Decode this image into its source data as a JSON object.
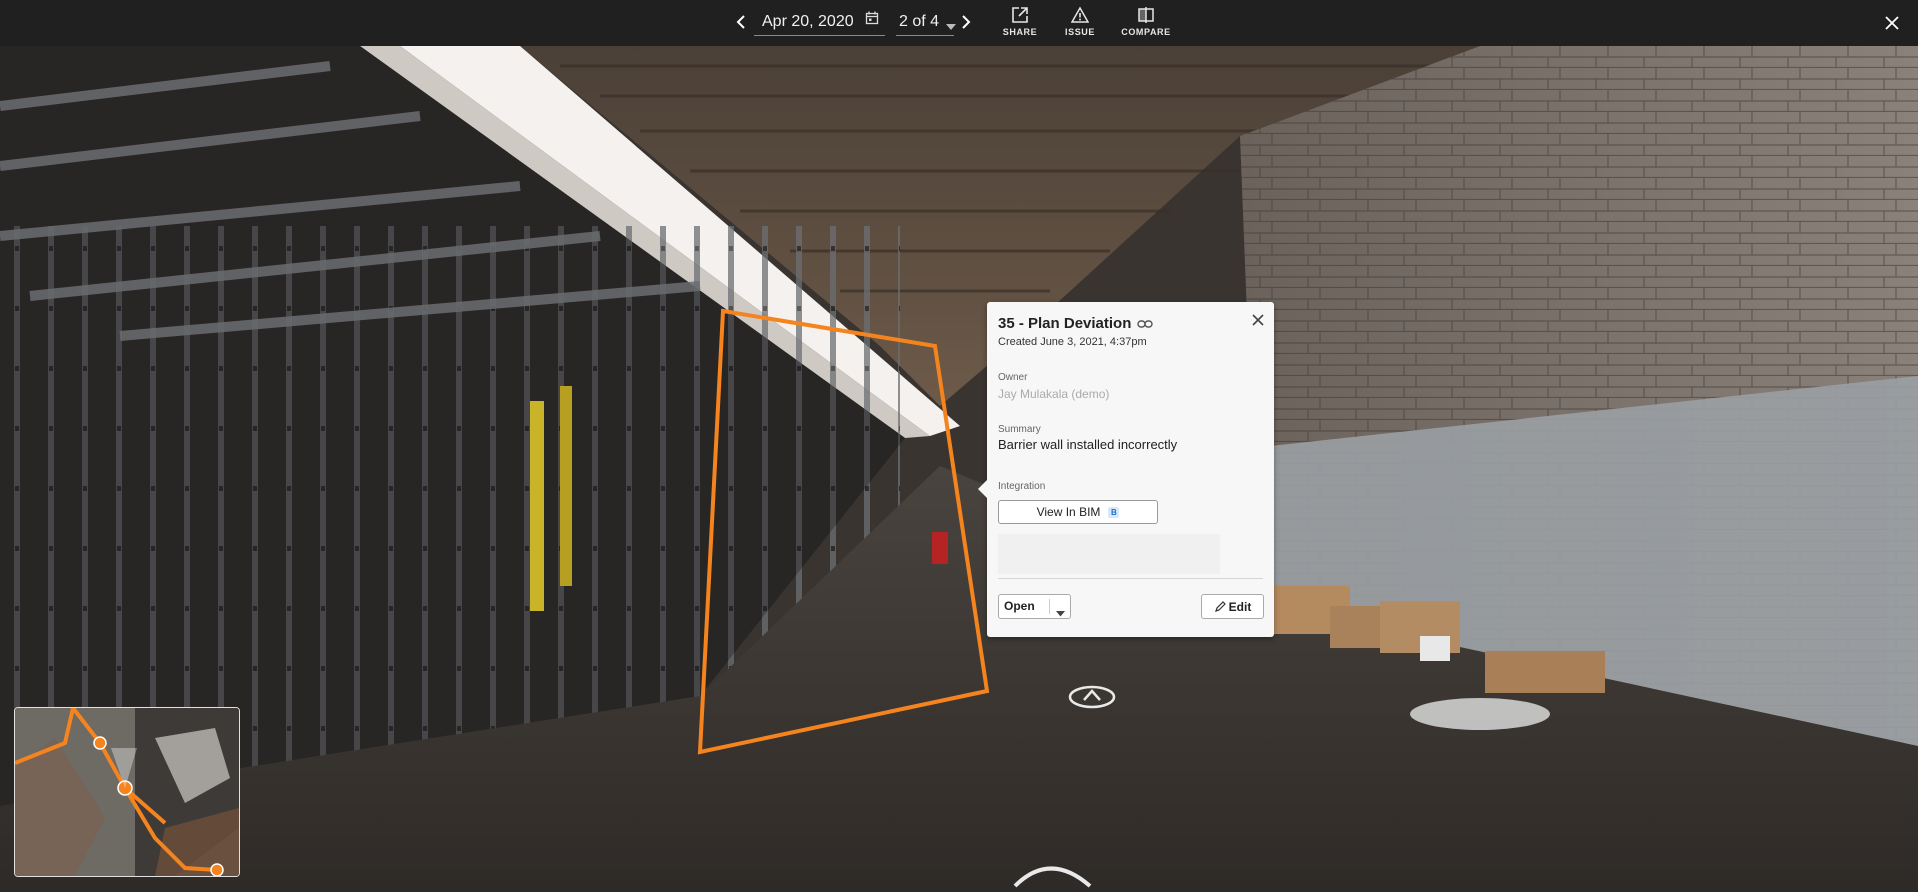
{
  "toolbar": {
    "date": "Apr 20, 2020",
    "capture": "2 of 4",
    "share_label": "SHARE",
    "issue_label": "ISSUE",
    "compare_label": "COMPARE"
  },
  "issue_popup": {
    "title": "35 - Plan Deviation",
    "created": "Created June 3, 2021, 4:37pm",
    "owner_label": "Owner",
    "owner": "Jay Mulakala (demo)",
    "summary_label": "Summary",
    "summary": "Barrier wall installed incorrectly",
    "integration_label": "Integration",
    "bim_button": "View In BIM",
    "bim_badge": "B",
    "status": "Open",
    "edit_label": "Edit"
  },
  "colors": {
    "accent": "#f5841f",
    "topbar": "#202020",
    "popup_bg": "#f7f7f7"
  },
  "icons": [
    "chevron-left-icon",
    "calendar-icon",
    "chevron-down-icon",
    "chevron-right-icon",
    "share-icon",
    "warning-icon",
    "compare-icon",
    "close-icon",
    "link-icon",
    "pencil-icon",
    "navigation-arrow-icon"
  ]
}
